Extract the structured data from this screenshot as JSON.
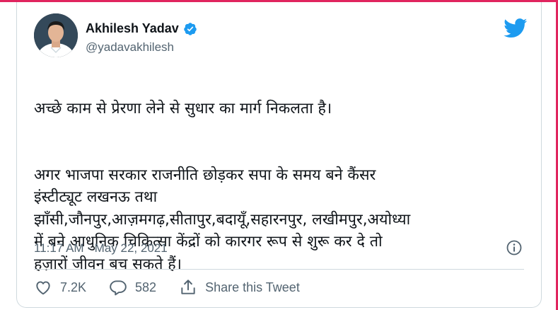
{
  "author": {
    "name": "Akhilesh Yadav",
    "handle": "@yadavakhilesh",
    "verified": true
  },
  "tweet": {
    "paragraph1": "अच्छे काम से प्रेरणा लेने से सुधार का मार्ग निकलता है।",
    "paragraph2": "अगर भाजपा सरकार राजनीति छोड़कर सपा के समय बने कैंसर\nइंस्टीट्यूट लखनऊ तथा\nझाँसी,जौनपुर,आज़मगढ़,सीतापुर,बदायूँ,सहारनपुर, लखीमपुर,अयोध्या\nमें बने आधुनिक चिकित्सा केंद्रों को कारगर रूप से शुरू कर दे तो\nहज़ारों जीवन बच सकते हैं।",
    "timestamp": "11:17 AM · May 22, 2021"
  },
  "actions": {
    "likes": "7.2K",
    "replies": "582",
    "share_label": "Share this Tweet"
  },
  "icons": {
    "brand": "twitter-bird-icon",
    "verified": "verified-badge-icon",
    "info": "info-icon",
    "like": "heart-icon",
    "reply": "reply-bubble-icon",
    "share": "share-icon"
  },
  "colors": {
    "brand": "#1d9bf0",
    "text": "#0f1419",
    "secondary": "#536471",
    "frame": "#e0245e"
  }
}
